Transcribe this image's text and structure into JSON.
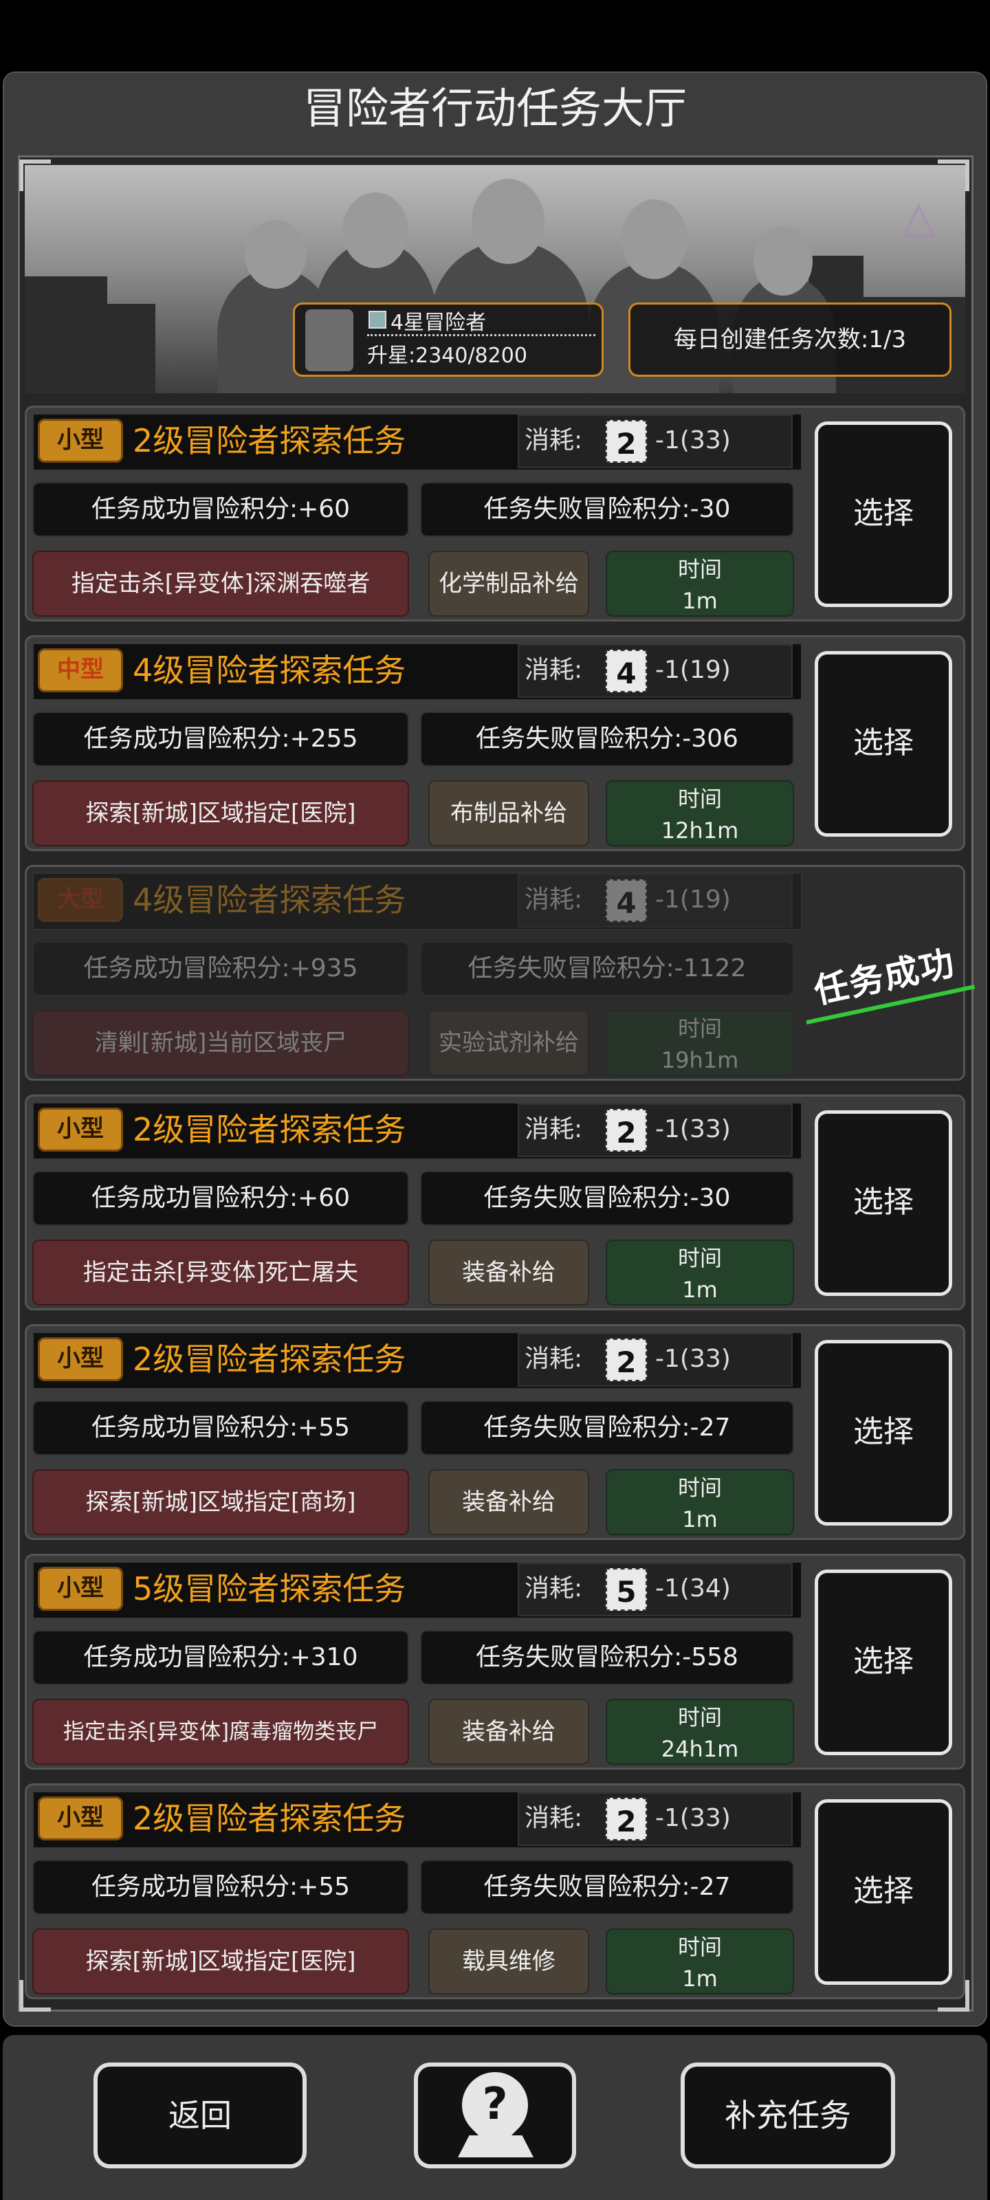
{
  "title": "冒险者行动任务大厅",
  "banner": {
    "rank_name": "4星冒险者",
    "rank_progress": "升星:2340/8200",
    "daily_create": "每日创建任务次数:1/3"
  },
  "tasks": [
    {
      "size": "小型",
      "name": "2级冒险者探索任务",
      "cost_label": "消耗:",
      "cost_level": "2",
      "cost_value": "-1(33)",
      "gain": "任务成功冒险积分:+60",
      "loss": "任务失败冒险积分:-30",
      "target": "指定击杀[异变体]深渊吞噬者",
      "supply": "化学制品补给",
      "time_label": "时间",
      "time_value": "1m",
      "select": "选择"
    },
    {
      "size": "中型",
      "name": "4级冒险者探索任务",
      "cost_label": "消耗:",
      "cost_level": "4",
      "cost_value": "-1(19)",
      "gain": "任务成功冒险积分:+255",
      "loss": "任务失败冒险积分:-306",
      "target": "探索[新城]区域指定[医院]",
      "supply": "布制品补给",
      "time_label": "时间",
      "time_value": "12h1m",
      "select": "选择"
    },
    {
      "size": "大型",
      "name": "4级冒险者探索任务",
      "cost_label": "消耗:",
      "cost_level": "4",
      "cost_value": "-1(19)",
      "gain": "任务成功冒险积分:+935",
      "loss": "任务失败冒险积分:-1122",
      "target": "清剿[新城]当前区域丧尸",
      "supply": "实验试剂补给",
      "time_label": "时间",
      "time_value": "19h1m",
      "status": "任务成功"
    },
    {
      "size": "小型",
      "name": "2级冒险者探索任务",
      "cost_label": "消耗:",
      "cost_level": "2",
      "cost_value": "-1(33)",
      "gain": "任务成功冒险积分:+60",
      "loss": "任务失败冒险积分:-30",
      "target": "指定击杀[异变体]死亡屠夫",
      "supply": "装备补给",
      "time_label": "时间",
      "time_value": "1m",
      "select": "选择"
    },
    {
      "size": "小型",
      "name": "2级冒险者探索任务",
      "cost_label": "消耗:",
      "cost_level": "2",
      "cost_value": "-1(33)",
      "gain": "任务成功冒险积分:+55",
      "loss": "任务失败冒险积分:-27",
      "target": "探索[新城]区域指定[商场]",
      "supply": "装备补给",
      "time_label": "时间",
      "time_value": "1m",
      "select": "选择"
    },
    {
      "size": "小型",
      "name": "5级冒险者探索任务",
      "cost_label": "消耗:",
      "cost_level": "5",
      "cost_value": "-1(34)",
      "gain": "任务成功冒险积分:+310",
      "loss": "任务失败冒险积分:-558",
      "target": "指定击杀[异变体]腐毒瘤物类丧尸",
      "supply": "装备补给",
      "time_label": "时间",
      "time_value": "24h1m",
      "select": "选择"
    },
    {
      "size": "小型",
      "name": "2级冒险者探索任务",
      "cost_label": "消耗:",
      "cost_level": "2",
      "cost_value": "-1(33)",
      "gain": "任务成功冒险积分:+55",
      "loss": "任务失败冒险积分:-27",
      "target": "探索[新城]区域指定[医院]",
      "supply": "载具维修",
      "time_label": "时间",
      "time_value": "1m",
      "select": "选择"
    }
  ],
  "bottom": {
    "back": "返回",
    "help_icon": "help-map-pin-icon",
    "refill": "补充任务"
  },
  "colors": {
    "accent_orange": "#f2a11a",
    "success_green": "#35c83a",
    "target_red": "#5d2a2d",
    "time_green": "#24412a"
  }
}
